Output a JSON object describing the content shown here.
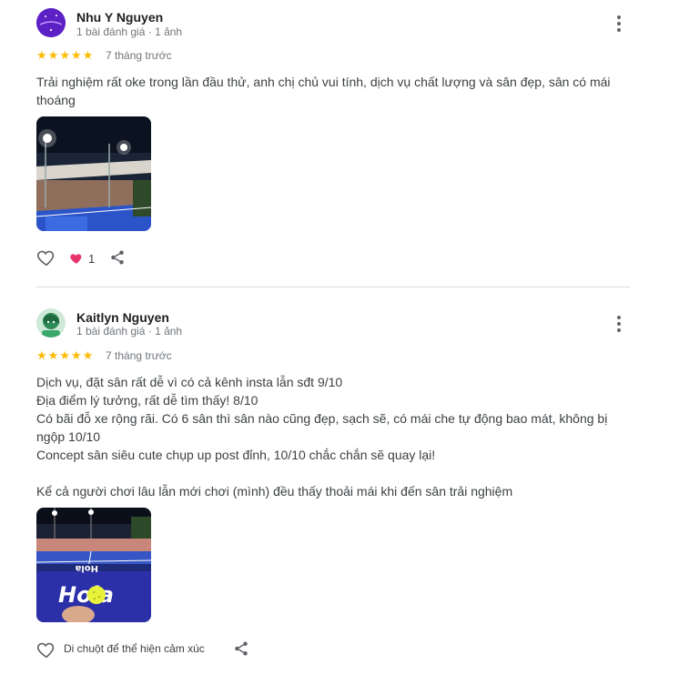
{
  "reviews": [
    {
      "name": "Nhu Y Nguyen",
      "meta": "1 bài đánh giá · 1 ảnh",
      "rating": 5,
      "time": "7 tháng trước",
      "text_lines": [
        "Trải nghiệm rất oke trong lần đầu thử, anh chị chủ vui tính, dịch vụ chất lượng và sân đẹp, sân có mái",
        "thoáng"
      ],
      "likes": "1",
      "photo_alt": "night-pickleball-court-photo"
    },
    {
      "name": "Kaitlyn Nguyen",
      "meta": "1 bài đánh giá · 1 ảnh",
      "rating": 5,
      "time": "7 tháng trước",
      "text_lines": [
        "Dịch vụ, đặt sân rất dễ vì có cả kênh insta lẫn sđt 9/10",
        "Địa điểm lý tưởng, rất dễ tìm thấy! 8/10",
        "Có bãi đỗ xe rộng rãi. Có 6 sân thì sân nào cũng đẹp, sạch sẽ, có mái che tự động bao mát, không bị",
        "ngộp 10/10",
        "Concept sân siêu cute chụp up post đỉnh, 10/10 chắc chắn sẽ quay lại!",
        "",
        "Kể cả người chơi lâu lẫn mới chơi (mình) đều thấy thoải mái khi đến sân trải nghiệm"
      ],
      "reaction_hint": "Di chuột để thể hiện cảm xúc",
      "photo_alt": "court-with-pickleball-photo",
      "photo_brand": "Hola"
    }
  ],
  "colors": {
    "star": "#fbbc04",
    "heart_filled": "#e8336b",
    "muted": "#70757a"
  }
}
